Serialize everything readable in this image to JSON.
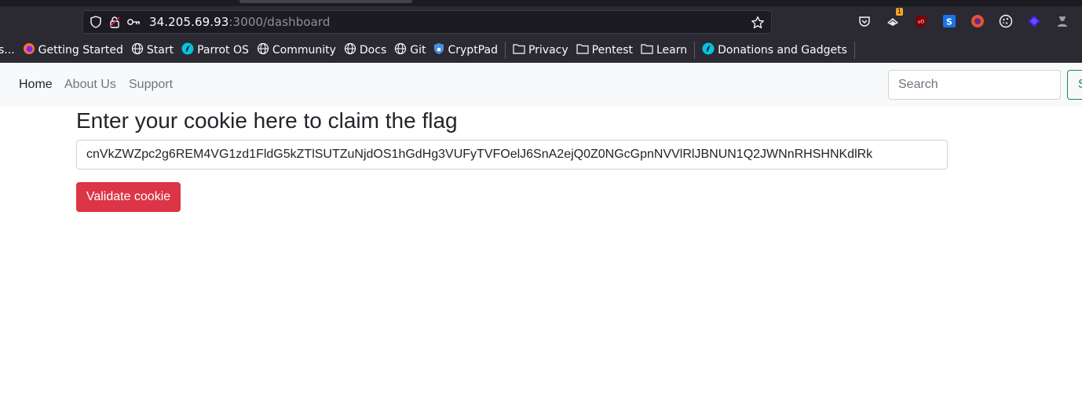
{
  "browser": {
    "url_host": "34.205.69.93",
    "url_rest": ":3000/dashboard",
    "extension_badge": "1",
    "bookmarks": [
      {
        "label": "s...",
        "icon": "truncated-bookmark"
      },
      {
        "label": "Getting Started",
        "icon": "firefox-icon"
      },
      {
        "label": "Start",
        "icon": "globe-icon"
      },
      {
        "label": "Parrot OS",
        "icon": "parrot-icon"
      },
      {
        "label": "Community",
        "icon": "globe-icon"
      },
      {
        "label": "Docs",
        "icon": "globe-icon"
      },
      {
        "label": "Git",
        "icon": "globe-icon"
      },
      {
        "label": "CryptPad",
        "icon": "cryptpad-icon"
      },
      {
        "label": "Privacy",
        "icon": "folder-icon"
      },
      {
        "label": "Pentest",
        "icon": "folder-icon"
      },
      {
        "label": "Learn",
        "icon": "folder-icon"
      },
      {
        "label": "Donations and Gadgets",
        "icon": "parrot-icon"
      }
    ]
  },
  "navbar": {
    "links": [
      "Home",
      "About Us",
      "Support"
    ],
    "search_placeholder": "Search",
    "search_button": "Search"
  },
  "main": {
    "heading": "Enter your cookie here to claim the flag",
    "cookie_value": "cnVkZWZpc2g6REM4VG1zd1FldG5kZTlSUTZuNjdOS1hGdHg3VUFyTVFOelJ6SnA2ejQ0Z0NGcGpnNVVlRlJBNUN1Q2JWNnRHSHNKdlRk",
    "validate_button": "Validate cookie"
  },
  "colors": {
    "chrome_bg": "#2b2a33",
    "navbar_bg": "#f8f9fa",
    "danger": "#dc3545",
    "success": "#198754"
  }
}
